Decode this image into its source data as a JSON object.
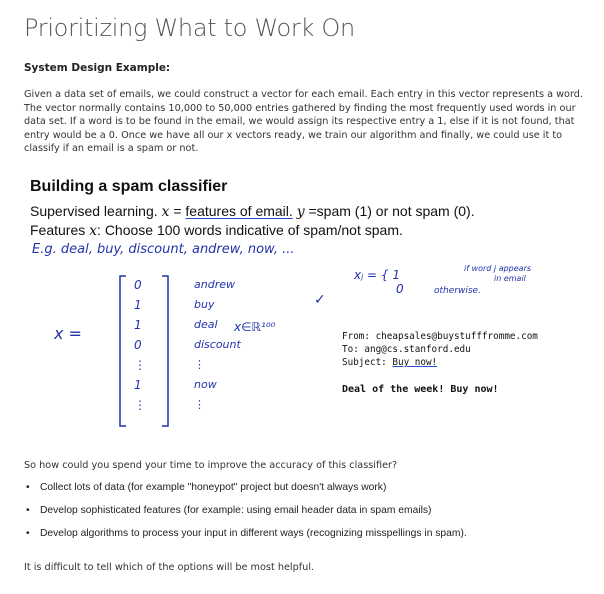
{
  "page": {
    "title": "Prioritizing What to Work On",
    "subheading": "System Design Example:",
    "intro": "Given a data set of emails, we could construct a vector for each email. Each entry in this vector represents a word. The vector normally contains 10,000 to 50,000 entries gathered by finding the most frequently used words in our data set. If a word is to be found in the email, we would assign its respective entry a 1, else if it is not found, that entry would be a 0. Once we have all our x vectors ready, we train our algorithm and finally, we could use it to classify if an email is a spam or not.",
    "question": "So how could you spend your time to improve the accuracy of this classifier?",
    "bullets": [
      "Collect lots of data (for example \"honeypot\" project but doesn't always work)",
      "Develop sophisticated features (for example: using email header data in spam emails)",
      "Develop algorithms to process your input in different ways (recognizing misspellings in spam)."
    ],
    "conclusion": "It is difficult to tell which of the options will be most helpful."
  },
  "slide": {
    "title": "Building a spam classifier",
    "line1_prefix": "Supervised learning.",
    "line1_x": "x",
    "line1_eq": " = ",
    "line1_features": "features of email.",
    "line1_y": "y",
    "line1_rest": " =spam (1) or not spam (0).",
    "line2_prefix": "Features ",
    "line2_x": "x",
    "line2_rest": ": Choose 100 words indicative of spam/not spam.",
    "handwriting": {
      "eg": "E.g. deal, buy, discount, andrew, now, ...",
      "big_x": "x =",
      "x_in_r": "x∈ℝ¹⁰⁰",
      "xj": "xⱼ = { 1",
      "xj_zero": "0",
      "ann_if": "if word j appears",
      "ann_in": "in email",
      "ann_otherwise": "otherwise.",
      "check": "✓"
    },
    "vector": [
      {
        "value": "0",
        "word": "andrew"
      },
      {
        "value": "1",
        "word": "buy"
      },
      {
        "value": "1",
        "word": "deal"
      },
      {
        "value": "0",
        "word": "discount"
      },
      {
        "value": "⋮",
        "word": "⋮"
      },
      {
        "value": "1",
        "word": "now"
      },
      {
        "value": "⋮",
        "word": "⋮"
      }
    ],
    "email": {
      "from": "From: cheapsales@buystufffromme.com",
      "to": "To: ang@cs.stanford.edu",
      "subject_label": "Subject: ",
      "subject": "Buy now!",
      "body": "Deal of the week! Buy now!"
    }
  }
}
